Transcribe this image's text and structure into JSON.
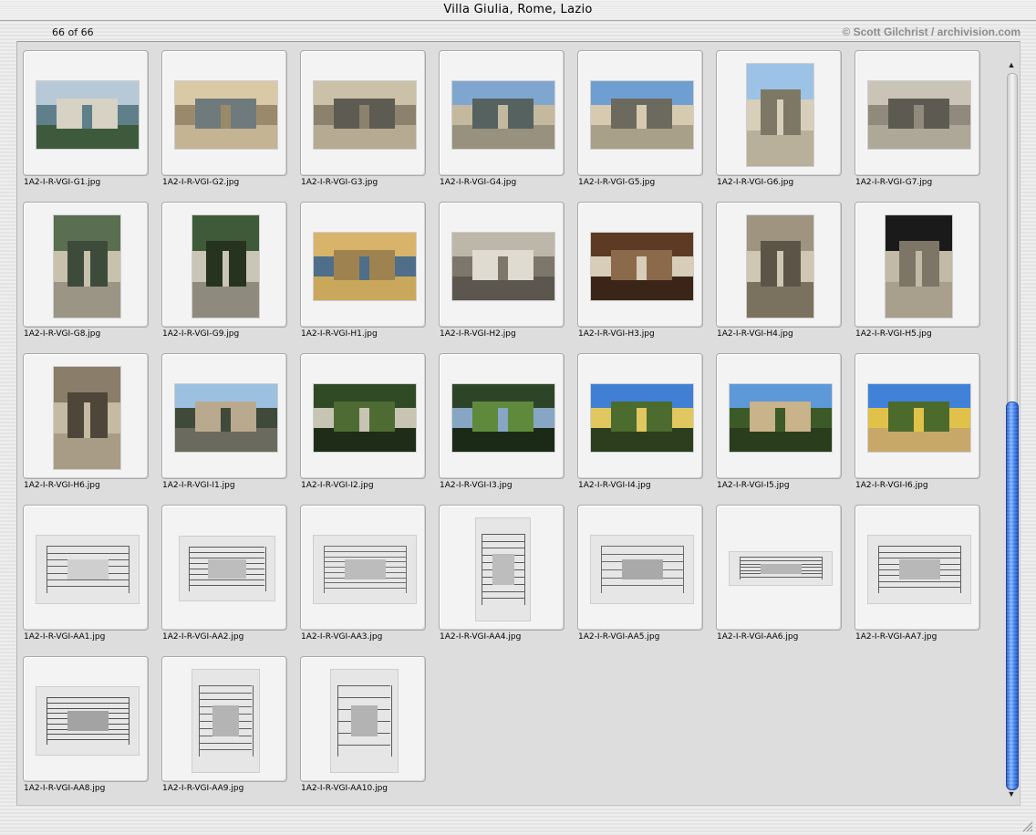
{
  "window": {
    "title": "Villa Giulia, Rome, Lazio"
  },
  "header": {
    "counter": "66 of 66",
    "credit": "© Scott Gilchrist / archivision.com"
  },
  "slides": [
    {
      "filename": "1A2-I-R-VGI-G1.jpg",
      "palette": [
        "#b7c9d6",
        "#5f7f8a",
        "#d6d2c4",
        "#3e5a3c"
      ]
    },
    {
      "filename": "1A2-I-R-VGI-G2.jpg",
      "palette": [
        "#d9c9a4",
        "#9a8a6c",
        "#6f7a7c",
        "#c4b494"
      ]
    },
    {
      "filename": "1A2-I-R-VGI-G3.jpg",
      "palette": [
        "#cbc0a8",
        "#8b816d",
        "#5e5b52",
        "#b6ab92"
      ]
    },
    {
      "filename": "1A2-I-R-VGI-G4.jpg",
      "palette": [
        "#7fa6cf",
        "#c4b99e",
        "#55625f",
        "#98917d"
      ]
    },
    {
      "filename": "1A2-I-R-VGI-G5.jpg",
      "palette": [
        "#6f9ed3",
        "#d6cbb0",
        "#6c6a5e",
        "#a9a08a"
      ]
    },
    {
      "filename": "1A2-I-R-VGI-G6.jpg",
      "palette": [
        "#9cc3e6",
        "#d7cfba",
        "#7d7866",
        "#b8b09a"
      ]
    },
    {
      "filename": "1A2-I-R-VGI-G7.jpg",
      "palette": [
        "#c9c4b6",
        "#8f8a7c",
        "#5d5a51",
        "#ada898"
      ]
    },
    {
      "filename": "1A2-I-R-VGI-G8.jpg",
      "palette": [
        "#5a6e52",
        "#c8c1ad",
        "#3d4b3a",
        "#9a9584"
      ]
    },
    {
      "filename": "1A2-I-R-VGI-G9.jpg",
      "palette": [
        "#3f5a38",
        "#c9c5b7",
        "#26331f",
        "#8e8b7e"
      ]
    },
    {
      "filename": "1A2-I-R-VGI-H1.jpg",
      "palette": [
        "#d8b46a",
        "#4e6e8a",
        "#9e8350",
        "#c9a85c"
      ]
    },
    {
      "filename": "1A2-I-R-VGI-H2.jpg",
      "palette": [
        "#bdb7a9",
        "#7c776a",
        "#e0dbd0",
        "#5b574e"
      ]
    },
    {
      "filename": "1A2-I-R-VGI-H3.jpg",
      "palette": [
        "#5c3a24",
        "#d7cdb9",
        "#8b6a4c",
        "#3a2518"
      ]
    },
    {
      "filename": "1A2-I-R-VGI-H4.jpg",
      "palette": [
        "#9e9480",
        "#cfc7b3",
        "#5c5547",
        "#7a715f"
      ]
    },
    {
      "filename": "1A2-I-R-VGI-H5.jpg",
      "palette": [
        "#1a1a1a",
        "#c2b9a6",
        "#7d7566",
        "#a89f8c"
      ]
    },
    {
      "filename": "1A2-I-R-VGI-H6.jpg",
      "palette": [
        "#8a7d69",
        "#c5baa4",
        "#4f463a",
        "#a99c86"
      ]
    },
    {
      "filename": "1A2-I-R-VGI-I1.jpg",
      "palette": [
        "#9cc0e0",
        "#3f4a3a",
        "#b9a98e",
        "#6a6a5e"
      ]
    },
    {
      "filename": "1A2-I-R-VGI-I2.jpg",
      "palette": [
        "#2f4a24",
        "#c7c4b4",
        "#4e6b34",
        "#1e2c18"
      ]
    },
    {
      "filename": "1A2-I-R-VGI-I3.jpg",
      "palette": [
        "#2e4426",
        "#87a6c4",
        "#5f8a3c",
        "#1b2a16"
      ]
    },
    {
      "filename": "1A2-I-R-VGI-I4.jpg",
      "palette": [
        "#3f7fd4",
        "#e0c760",
        "#4c6b2e",
        "#2c3e1e"
      ]
    },
    {
      "filename": "1A2-I-R-VGI-I5.jpg",
      "palette": [
        "#5d98d8",
        "#3c5a28",
        "#c9b38a",
        "#2a3d1c"
      ]
    },
    {
      "filename": "1A2-I-R-VGI-I6.jpg",
      "palette": [
        "#3f82d8",
        "#e0c24a",
        "#4c6a2c",
        "#c8a868"
      ]
    },
    {
      "filename": "1A2-I-R-VGI-AA1.jpg",
      "palette": [
        "#a9a9a9",
        "#7d7d7d",
        "#cfcfcf",
        "#5e5e5e"
      ]
    },
    {
      "filename": "1A2-I-R-VGI-AA2.jpg",
      "palette": [
        "#e4e4e4",
        "#8c8c8c",
        "#bdbdbd",
        "#5a5a5a"
      ]
    },
    {
      "filename": "1A2-I-R-VGI-AA3.jpg",
      "palette": [
        "#d6d6d6",
        "#9a9a9a",
        "#bcbcbc",
        "#6e6e6e"
      ]
    },
    {
      "filename": "1A2-I-R-VGI-AA4.jpg",
      "palette": [
        "#dcdcdc",
        "#8a8a8a",
        "#bdbdbd",
        "#5b5b5b"
      ]
    },
    {
      "filename": "1A2-I-R-VGI-AA5.jpg",
      "palette": [
        "#d9d9d9",
        "#3e3e3e",
        "#a9a9a9",
        "#6b6b6b"
      ]
    },
    {
      "filename": "1A2-I-R-VGI-AA6.jpg",
      "palette": [
        "#d8d8d8",
        "#8f8f8f",
        "#b6b6b6",
        "#606060"
      ]
    },
    {
      "filename": "1A2-I-R-VGI-AA7.jpg",
      "palette": [
        "#dadada",
        "#8a8a8a",
        "#b8b8b8",
        "#5c5c5c"
      ]
    },
    {
      "filename": "1A2-I-R-VGI-AA8.jpg",
      "palette": [
        "#c6c6c6",
        "#777777",
        "#a3a3a3",
        "#4f4f4f"
      ]
    },
    {
      "filename": "1A2-I-R-VGI-AA9.jpg",
      "palette": [
        "#d8d8d8",
        "#8d8d8d",
        "#b4b4b4",
        "#5f5f5f"
      ]
    },
    {
      "filename": "1A2-I-R-VGI-AA10.jpg",
      "palette": [
        "#d4d4d4",
        "#8a8a8a",
        "#b3b3b3",
        "#5c5c5c"
      ]
    }
  ],
  "icons": {
    "scroll_up": "scroll-up-arrow-icon",
    "scroll_down": "scroll-down-arrow-icon",
    "resize": "resize-grip-icon"
  }
}
